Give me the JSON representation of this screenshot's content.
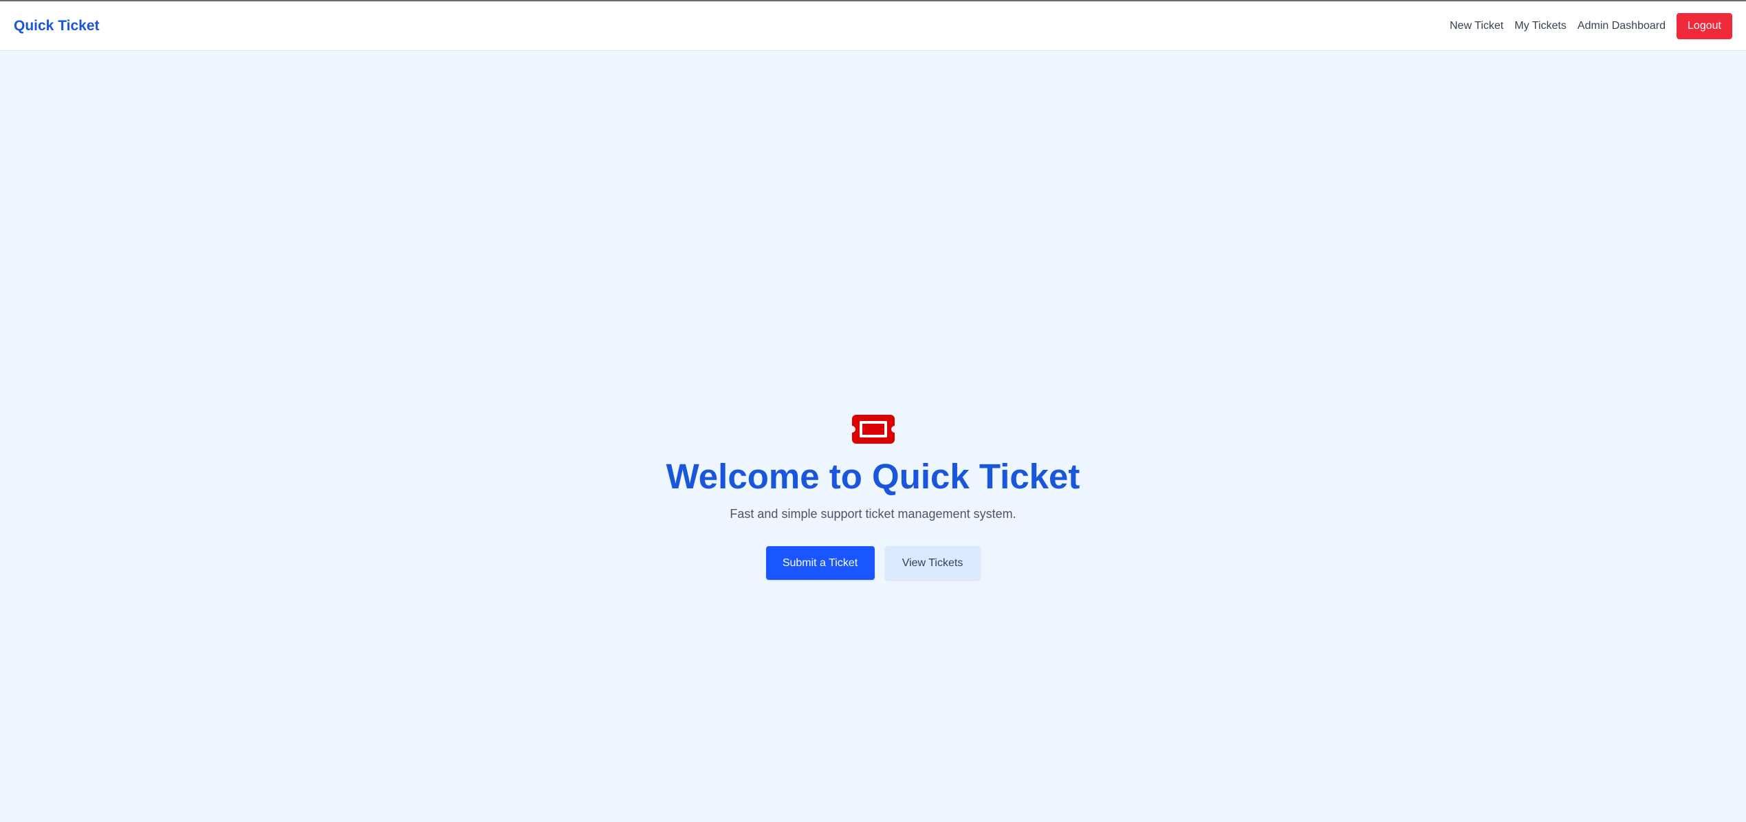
{
  "navbar": {
    "brand": "Quick Ticket",
    "links": [
      {
        "label": "New Ticket"
      },
      {
        "label": "My Tickets"
      },
      {
        "label": "Admin Dashboard"
      }
    ],
    "logout_label": "Logout"
  },
  "hero": {
    "icon": "ticket-icon",
    "title": "Welcome to Quick Ticket",
    "subtitle": "Fast and simple support ticket management system.",
    "primary_button": "Submit a Ticket",
    "secondary_button": "View Tickets"
  },
  "colors": {
    "brand": "#1a56db",
    "primary_button": "#1a56ff",
    "logout_button": "#f0293b",
    "ticket_icon": "#dc0000",
    "background": "#eef6ff"
  }
}
